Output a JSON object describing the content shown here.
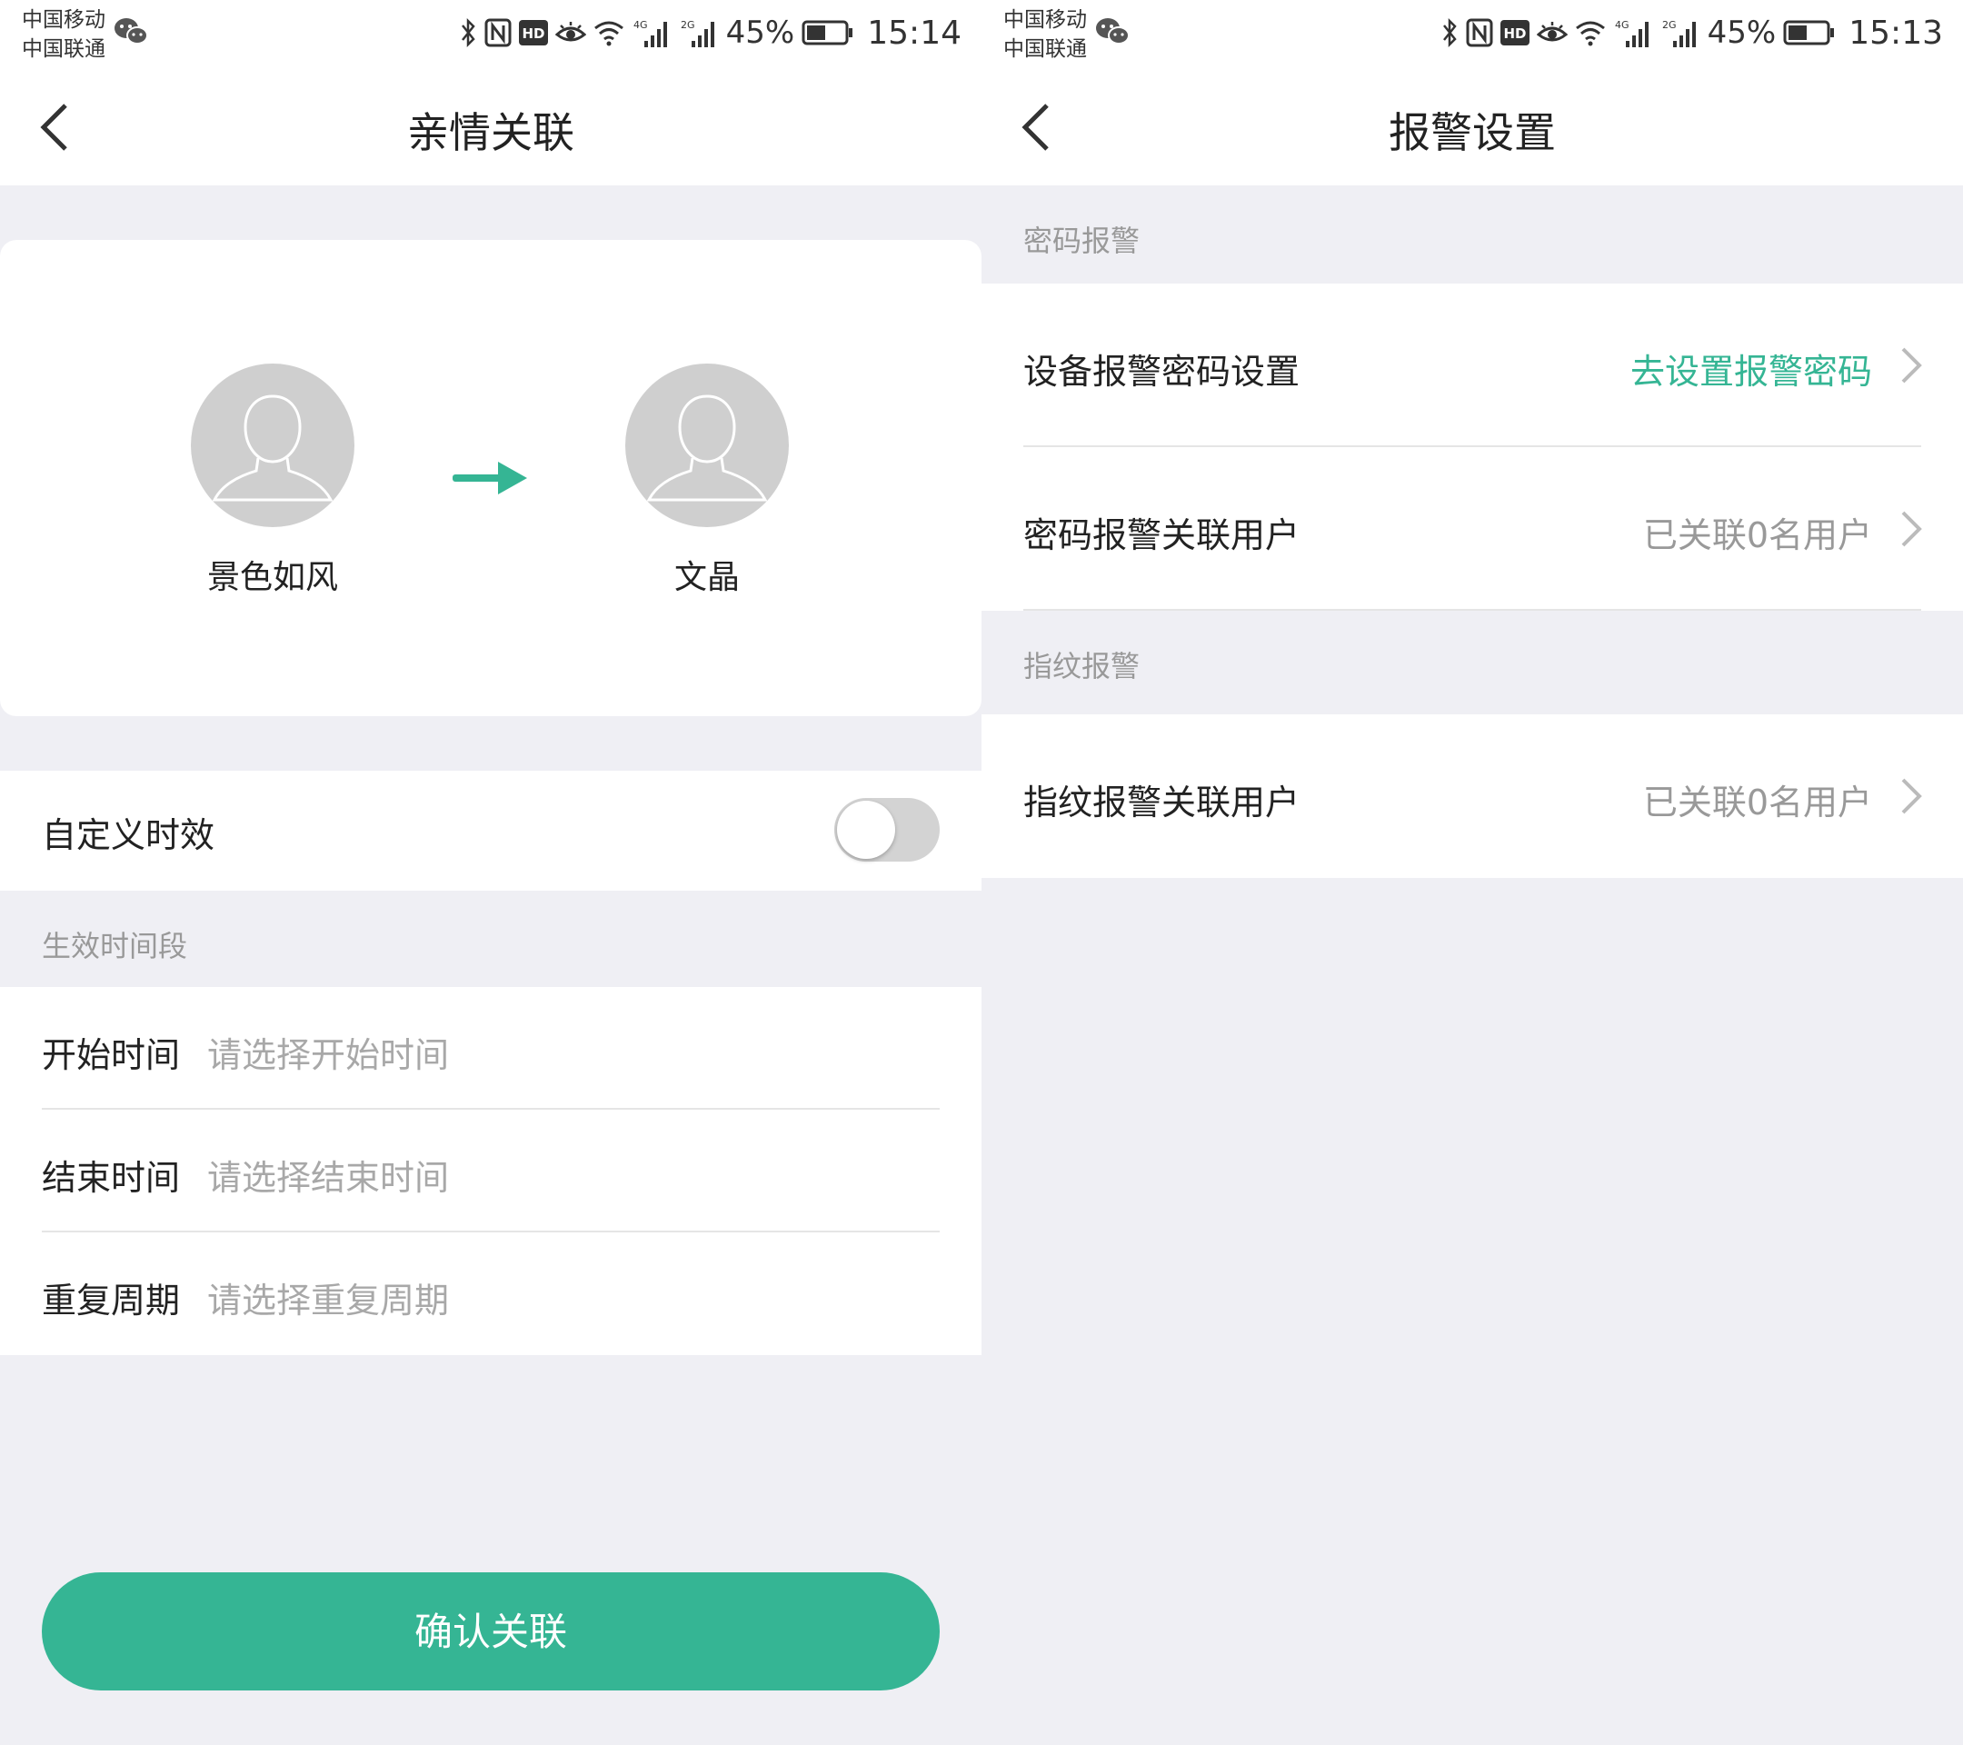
{
  "status_bar": {
    "carrier_1": "中国移动",
    "carrier_2": "中国联通",
    "battery": "45%",
    "network_1": "4G",
    "network_2": "2G"
  },
  "left": {
    "status_time": "15:14",
    "title": "亲情关联",
    "from_user": "景色如风",
    "to_user": "文晶",
    "custom_time_label": "自定义时效",
    "custom_time_enabled": false,
    "section_label": "生效时间段",
    "rows": [
      {
        "label": "开始时间",
        "placeholder": "请选择开始时间"
      },
      {
        "label": "结束时间",
        "placeholder": "请选择结束时间"
      },
      {
        "label": "重复周期",
        "placeholder": "请选择重复周期"
      }
    ],
    "confirm_label": "确认关联"
  },
  "right": {
    "status_time": "15:13",
    "title": "报警设置",
    "section_password": "密码报警",
    "password_rows": [
      {
        "label": "设备报警密码设置",
        "value": "去设置报警密码"
      },
      {
        "label": "密码报警关联用户",
        "value": "已关联0名用户"
      }
    ],
    "section_fingerprint": "指纹报警",
    "fingerprint_rows": [
      {
        "label": "指纹报警关联用户",
        "value": "已关联0名用户"
      }
    ]
  },
  "colors": {
    "accent": "#35b594",
    "background": "#efeff4",
    "avatar": "#cfcfcf",
    "toggle_off": "#d3d3d3"
  },
  "icons": [
    "back-icon",
    "wechat-icon",
    "bluetooth-icon",
    "nfc-icon",
    "hd-icon",
    "eye-icon",
    "wifi-icon",
    "signal-icon",
    "battery-icon",
    "user-avatar-icon",
    "arrow-right-icon",
    "chevron-right-icon"
  ]
}
